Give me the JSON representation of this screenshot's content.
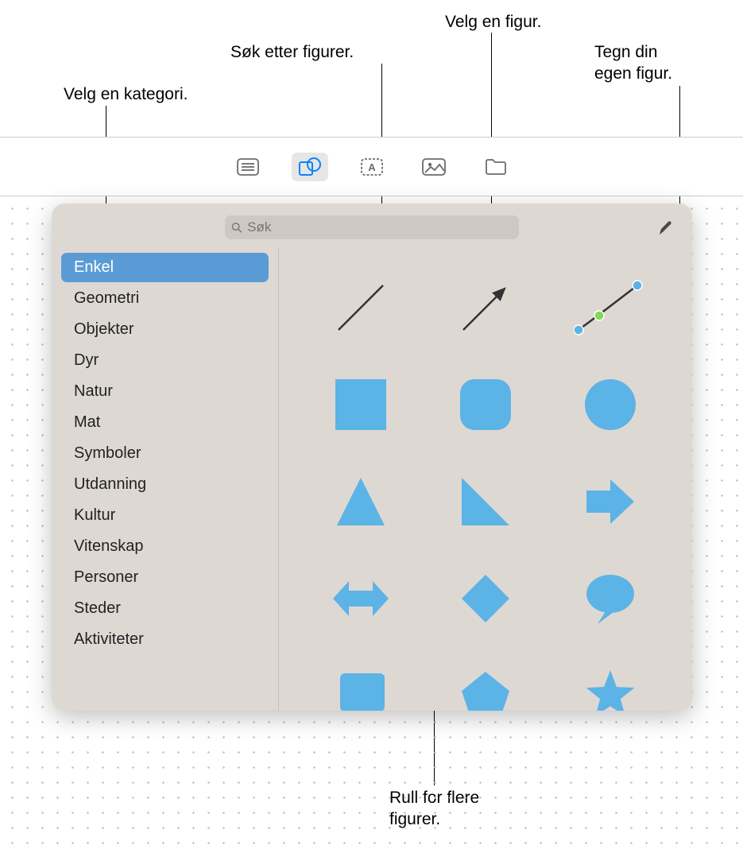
{
  "callouts": {
    "category": "Velg en kategori.",
    "search": "Søk etter figurer.",
    "pick": "Velg en figur.",
    "draw_line1": "Tegn din",
    "draw_line2": "egen figur.",
    "scroll_line1": "Rull for flere",
    "scroll_line2": "figurer."
  },
  "search": {
    "placeholder": "Søk"
  },
  "sidebar": {
    "items": [
      {
        "label": "Enkel",
        "selected": true
      },
      {
        "label": "Geometri"
      },
      {
        "label": "Objekter"
      },
      {
        "label": "Dyr"
      },
      {
        "label": "Natur"
      },
      {
        "label": "Mat"
      },
      {
        "label": "Symboler"
      },
      {
        "label": "Utdanning"
      },
      {
        "label": "Kultur"
      },
      {
        "label": "Vitenskap"
      },
      {
        "label": "Personer"
      },
      {
        "label": "Steder"
      },
      {
        "label": "Aktiviteter"
      }
    ]
  },
  "shapes": [
    {
      "name": "line"
    },
    {
      "name": "arrow-line"
    },
    {
      "name": "curve"
    },
    {
      "name": "square"
    },
    {
      "name": "rounded-square"
    },
    {
      "name": "circle"
    },
    {
      "name": "triangle"
    },
    {
      "name": "right-triangle"
    },
    {
      "name": "arrow-right"
    },
    {
      "name": "double-arrow"
    },
    {
      "name": "diamond"
    },
    {
      "name": "speech-bubble"
    },
    {
      "name": "callout-rect"
    },
    {
      "name": "pentagon"
    },
    {
      "name": "star"
    }
  ],
  "colors": {
    "shape": "#5cb3e6",
    "accent": "#5a9bd5"
  }
}
